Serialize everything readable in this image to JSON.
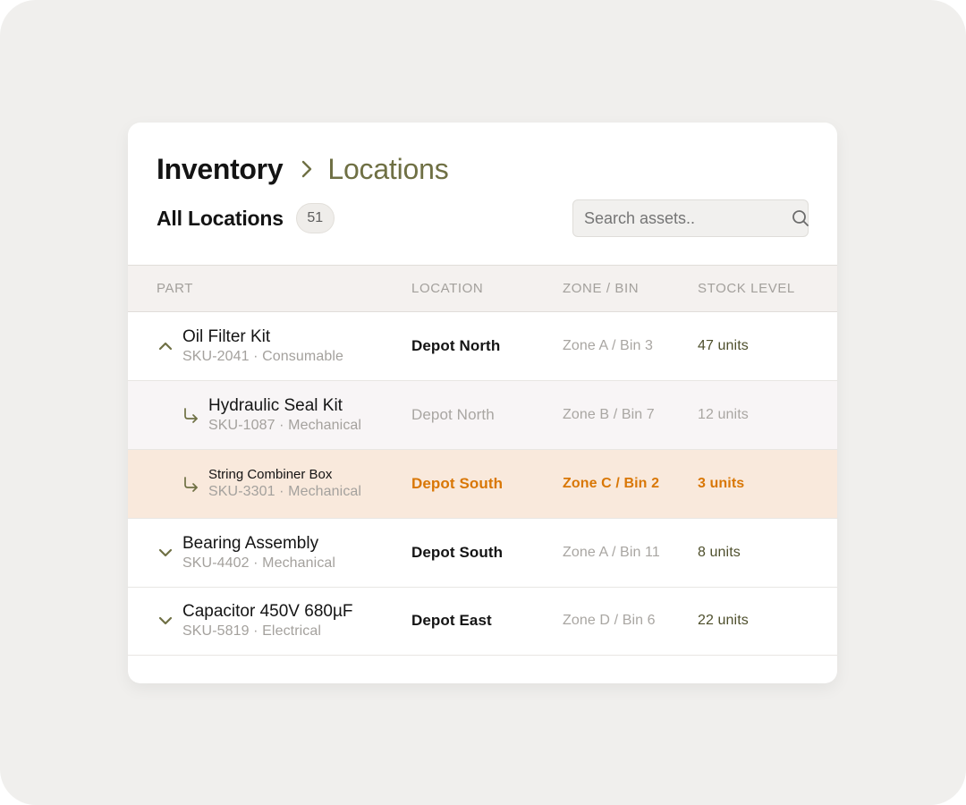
{
  "breadcrumb": {
    "root": "Inventory",
    "current": "Locations"
  },
  "subheader": {
    "title": "All Locations",
    "count": "51"
  },
  "search": {
    "placeholder": "Search assets.."
  },
  "columns": {
    "part": "PART",
    "location": "LOCATION",
    "zone": "ZONE / BIN",
    "stock": "STOCK LEVEL"
  },
  "colors": {
    "accent": "#6f7044",
    "alert": "#d97706",
    "child_row_bg": "#f8f5f6",
    "alert_row_bg": "#f9e9dc"
  },
  "rows": [
    {
      "name": "Oil Filter Kit",
      "meta": "SKU-2041 · Consumable",
      "location": "Depot North",
      "zone": "Zone A / Bin 3",
      "stock": "47 units",
      "toggle_icon": "chevron-up-icon",
      "state": "expanded"
    },
    {
      "name": "Hydraulic Seal Kit",
      "meta": "SKU-1087 · Mechanical",
      "location": "Depot North",
      "zone": "Zone B / Bin 7",
      "stock": "12 units",
      "toggle_icon": "child-arrow-icon",
      "state": "child"
    },
    {
      "name": "String Combiner Box",
      "meta": "SKU-3301 · Mechanical",
      "location": "Depot South",
      "zone": "Zone C / Bin 2",
      "stock": "3 units",
      "toggle_icon": "child-arrow-icon",
      "state": "low-stock"
    },
    {
      "name": "Bearing Assembly",
      "meta": "SKU-4402 · Mechanical",
      "location": "Depot South",
      "zone": "Zone A / Bin 11",
      "stock": "8 units",
      "toggle_icon": "chevron-down-icon",
      "state": "collapsed"
    },
    {
      "name": "Capacitor 450V 680µF",
      "meta": "SKU-5819 · Electrical",
      "location": "Depot East",
      "zone": "Zone D / Bin 6",
      "stock": "22 units",
      "toggle_icon": "chevron-down-icon",
      "state": "collapsed"
    }
  ]
}
